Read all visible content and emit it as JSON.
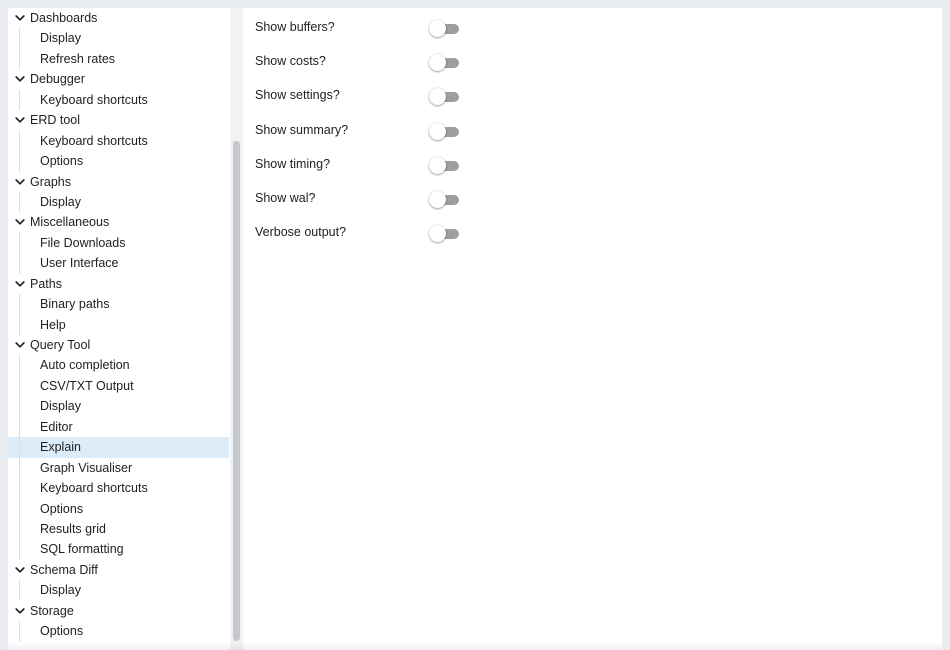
{
  "sidebar": {
    "groups": [
      {
        "label": "Dashboards",
        "items": [
          "Display",
          "Refresh rates"
        ]
      },
      {
        "label": "Debugger",
        "items": [
          "Keyboard shortcuts"
        ]
      },
      {
        "label": "ERD tool",
        "items": [
          "Keyboard shortcuts",
          "Options"
        ]
      },
      {
        "label": "Graphs",
        "items": [
          "Display"
        ]
      },
      {
        "label": "Miscellaneous",
        "items": [
          "File Downloads",
          "User Interface"
        ]
      },
      {
        "label": "Paths",
        "items": [
          "Binary paths",
          "Help"
        ]
      },
      {
        "label": "Query Tool",
        "items": [
          "Auto completion",
          "CSV/TXT Output",
          "Display",
          "Editor",
          "Explain",
          "Graph Visualiser",
          "Keyboard shortcuts",
          "Options",
          "Results grid",
          "SQL formatting"
        ]
      },
      {
        "label": "Schema Diff",
        "items": [
          "Display"
        ]
      },
      {
        "label": "Storage",
        "items": [
          "Options"
        ]
      }
    ],
    "selected": {
      "group": 6,
      "item": 4
    },
    "chevron_icon": "chevron-down-icon"
  },
  "explain_options": [
    {
      "label": "Show buffers?",
      "enabled": false
    },
    {
      "label": "Show costs?",
      "enabled": false
    },
    {
      "label": "Show settings?",
      "enabled": false
    },
    {
      "label": "Show summary?",
      "enabled": false
    },
    {
      "label": "Show timing?",
      "enabled": false
    },
    {
      "label": "Show wal?",
      "enabled": false
    },
    {
      "label": "Verbose output?",
      "enabled": false
    }
  ],
  "colors": {
    "selected_row": "#dcecf8",
    "toggle_track_off": "#9e9e9e",
    "toggle_knob": "#ffffff"
  }
}
